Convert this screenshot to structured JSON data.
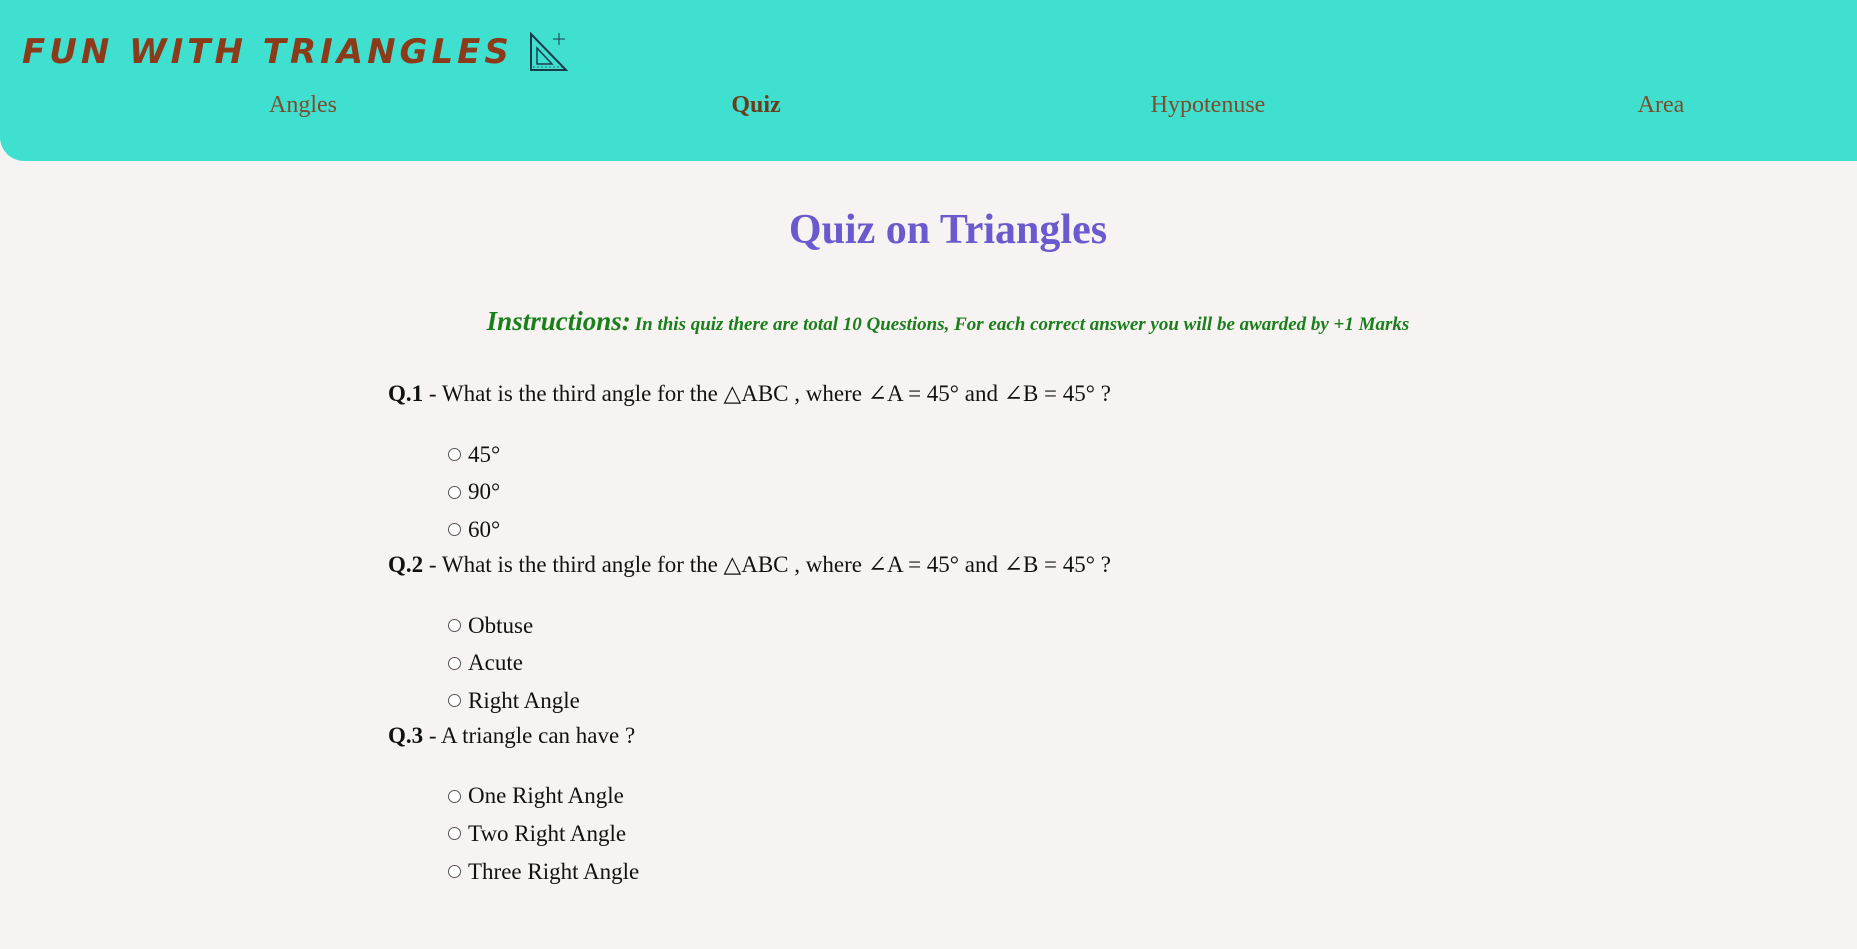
{
  "header": {
    "brand": "FUN WITH TRIANGLES",
    "logo_icon": "set-square-icon",
    "nav": [
      {
        "label": "Angles",
        "active": false
      },
      {
        "label": "Quiz",
        "active": true
      },
      {
        "label": "Hypotenuse",
        "active": false
      },
      {
        "label": "Area",
        "active": false
      }
    ]
  },
  "main": {
    "title": "Quiz on Triangles",
    "instructions_label": "Instructions:",
    "instructions_text": "In this quiz there are total 10 Questions, For each correct answer you will be awarded by +1 Marks",
    "questions": [
      {
        "number": "Q.1",
        "text": " - What is the third angle for the △ABC , where ∠A = 45° and ∠B = 45° ?",
        "options": [
          "45°",
          "90°",
          "60°"
        ]
      },
      {
        "number": "Q.2",
        "text": " - What is the third angle for the △ABC , where ∠A = 45° and ∠B = 45° ?",
        "options": [
          "Obtuse",
          "Acute",
          "Right Angle"
        ]
      },
      {
        "number": "Q.3",
        "text": " - A triangle can have ?",
        "options": [
          "One Right Angle",
          "Two Right Angle",
          "Three Right Angle"
        ]
      }
    ]
  },
  "colors": {
    "header_bg": "#40e0d0",
    "brand": "#8b3a1a",
    "title": "#6a5acd",
    "instructions": "#1a7f1a",
    "page_bg": "#f7f3f3"
  }
}
